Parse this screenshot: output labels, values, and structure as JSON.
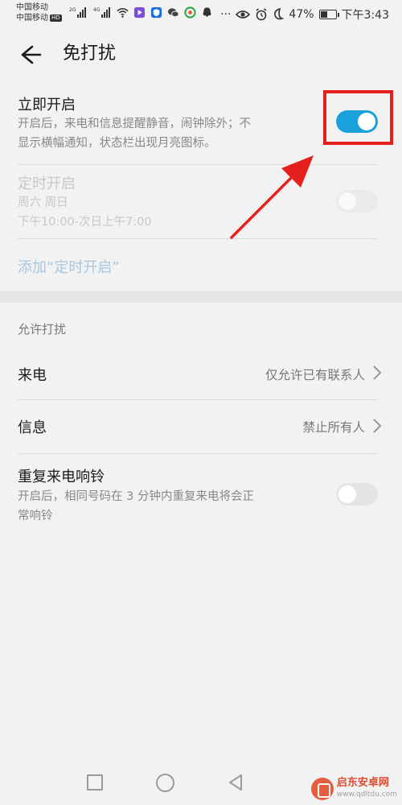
{
  "status_bar": {
    "carrier1": "中国移动",
    "carrier2": "中国移动",
    "hd": "HD",
    "net1": "2G",
    "net2": "4G",
    "battery_text": "47%",
    "battery_level": 0.47,
    "time": "下午3:43"
  },
  "header": {
    "title": "免打扰"
  },
  "immediate": {
    "title": "立即开启",
    "desc_line1": "开启后，来电和信息提醒静音，闹钟除外；不",
    "desc_line2": "显示横幅通知，状态栏出现月亮图标。",
    "switch_on": true
  },
  "scheduled": {
    "title": "定时开启",
    "days": "周六 周日",
    "time_range": "下午10:00-次日上午7:00",
    "switch_on": false
  },
  "add_link": "添加“定时开启”",
  "allow_section": {
    "label": "允许打扰",
    "calls_label": "来电",
    "calls_value": "仅允许已有联系人",
    "messages_label": "信息",
    "messages_value": "禁止所有人"
  },
  "repeat": {
    "title": "重复来电响铃",
    "desc_line1": "开启后，相同号码在 3 分钟内重复来电将会正",
    "desc_line2": "常响铃",
    "switch_on": false
  },
  "watermark": {
    "name": "启东安卓网",
    "url": "www.qdltdu.com"
  },
  "colors": {
    "accent": "#1aa1dc",
    "highlight": "#e3201b",
    "arrow": "#e3201b"
  }
}
